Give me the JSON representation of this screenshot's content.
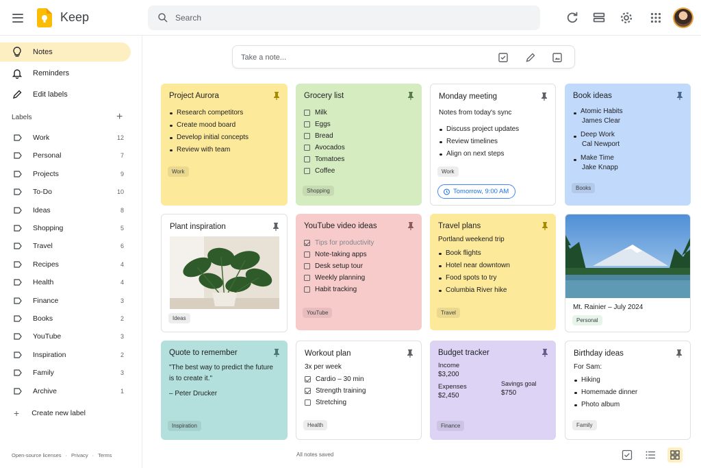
{
  "app": {
    "title": "Keep"
  },
  "search": {
    "placeholder": "Search"
  },
  "sidebar": {
    "nav": [
      {
        "label": "Notes",
        "icon": "bulb-icon",
        "active": true
      },
      {
        "label": "Reminders",
        "icon": "bell-icon"
      },
      {
        "label": "Edit labels",
        "icon": "pencil-icon"
      }
    ],
    "labels_heading": "Labels",
    "labels": [
      {
        "label": "Work",
        "count": "12"
      },
      {
        "label": "Personal",
        "count": "7"
      },
      {
        "label": "Projects",
        "count": "9"
      },
      {
        "label": "To-Do",
        "count": "10"
      },
      {
        "label": "Ideas",
        "count": "8"
      },
      {
        "label": "Shopping",
        "count": "5"
      },
      {
        "label": "Travel",
        "count": "6"
      },
      {
        "label": "Recipes",
        "count": "4"
      },
      {
        "label": "Health",
        "count": "4"
      },
      {
        "label": "Finance",
        "count": "3"
      },
      {
        "label": "Books",
        "count": "2"
      },
      {
        "label": "YouTube",
        "count": "3"
      },
      {
        "label": "Inspiration",
        "count": "2"
      },
      {
        "label": "Family",
        "count": "3"
      },
      {
        "label": "Archive",
        "count": "1"
      }
    ],
    "create_label": "Create new label",
    "footer": [
      "Open-source licenses",
      "Privacy",
      "Terms"
    ]
  },
  "take_note": {
    "placeholder": "Take a note..."
  },
  "notes": {
    "project_aurora": {
      "title": "Project Aurora",
      "items": [
        "Research competitors",
        "Create mood board",
        "Develop initial concepts",
        "Review with team"
      ],
      "label": "Work",
      "color": "#fde99a"
    },
    "grocery": {
      "title": "Grocery list",
      "items": [
        "Milk",
        "Eggs",
        "Bread",
        "Avocados",
        "Tomatoes",
        "Coffee"
      ],
      "label": "Shopping",
      "color": "#d5ecc0"
    },
    "monday": {
      "title": "Monday meeting",
      "intro": "Notes from today's sync",
      "items": [
        "Discuss project updates",
        "Review timelines",
        "Align on next steps"
      ],
      "label": "Work",
      "reminder": "Tomorrow, 9:00 AM"
    },
    "books": {
      "title": "Book ideas",
      "items": [
        {
          "name": "Atomic Habits",
          "author": "James Clear"
        },
        {
          "name": "Deep Work",
          "author": "Cal Newport"
        },
        {
          "name": "Make Time",
          "author": "Jake Knapp"
        }
      ],
      "label": "Books",
      "color": "#c1d9fb"
    },
    "plant": {
      "title": "Plant inspiration",
      "label": "Ideas"
    },
    "youtube": {
      "title": "YouTube video ideas",
      "done": "Tips for productivity",
      "items": [
        "Note-taking apps",
        "Desk setup tour",
        "Weekly planning",
        "Habit tracking"
      ],
      "label": "YouTube",
      "color": "#f8cbcb"
    },
    "travel": {
      "title": "Travel plans",
      "intro": "Portland weekend trip",
      "items": [
        "Book flights",
        "Hotel near downtown",
        "Food spots to try",
        "Columbia River hike"
      ],
      "label": "Travel",
      "color": "#fde99a"
    },
    "rainier": {
      "caption": "Mt. Rainier – July 2024",
      "label": "Personal"
    },
    "quote": {
      "title": "Quote to remember",
      "text": "\"The best way to predict the future is to create it.\"",
      "author": "– Peter Drucker",
      "label": "Inspiration",
      "color": "#b3e0dc"
    },
    "workout": {
      "title": "Workout plan",
      "intro": "3x per week",
      "items": [
        {
          "text": "Cardio – 30 min",
          "checked": true
        },
        {
          "text": "Strength training",
          "checked": true
        },
        {
          "text": "Stretching",
          "checked": false
        }
      ],
      "label": "Health"
    },
    "budget": {
      "title": "Budget tracker",
      "income_label": "Income",
      "income": "$3,200",
      "expenses_label": "Expenses",
      "expenses": "$2,450",
      "savings_label": "Savings goal",
      "savings": "$750",
      "label": "Finance",
      "color": "#dcd3f5"
    },
    "birthday": {
      "title": "Birthday ideas",
      "intro": "For Sam:",
      "items": [
        "Hiking",
        "Homemade dinner",
        "Photo album"
      ],
      "label": "Family"
    }
  },
  "status": {
    "saved": "All notes saved"
  }
}
